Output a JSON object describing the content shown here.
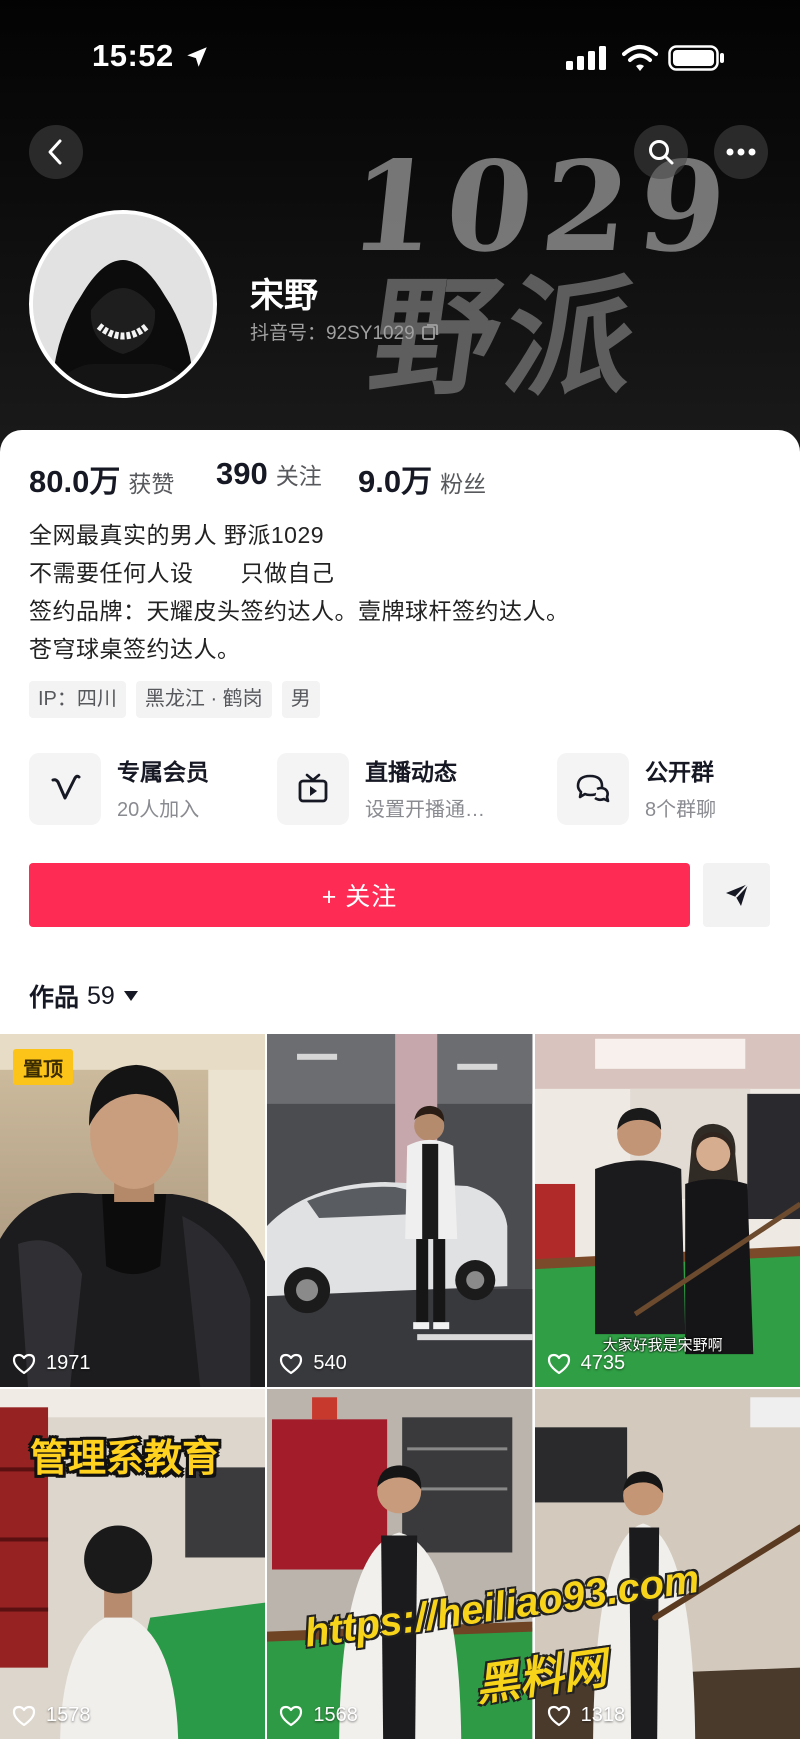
{
  "status_bar": {
    "time": "15:52",
    "icons": [
      "location-arrow-icon",
      "signal-icon",
      "wifi-icon",
      "battery-icon"
    ]
  },
  "banner": {
    "line1": "1029",
    "line2": "野派"
  },
  "profile": {
    "name": "宋野",
    "douyin_id": "抖音号：92SY1029"
  },
  "stats": [
    {
      "value": "80.0万",
      "label": "获赞"
    },
    {
      "value": "390",
      "label": "关注"
    },
    {
      "value": "9.0万",
      "label": "粉丝"
    }
  ],
  "bio": [
    "全网最真实的男人 野派1029",
    "不需要任何人设　　只做自己",
    "签约品牌：天耀皮头签约达人。壹牌球杆签约达人。",
    "苍穹球桌签约达人。"
  ],
  "tags": [
    "IP：四川",
    "黑龙江 · 鹤岗",
    "男"
  ],
  "features": [
    {
      "title": "专属会员",
      "subtitle": "20人加入",
      "icon": "member-v-icon"
    },
    {
      "title": "直播动态",
      "subtitle": "设置开播通…",
      "icon": "tv-icon"
    },
    {
      "title": "公开群",
      "subtitle": "8个群聊",
      "icon": "chat-bubbles-icon"
    }
  ],
  "follow_button": {
    "label": "+ 关注"
  },
  "works": {
    "label": "作品",
    "count": "59"
  },
  "videos": [
    {
      "likes": "1971",
      "badge": "置顶"
    },
    {
      "likes": "540"
    },
    {
      "likes": "4735",
      "caption": "大家好我是宋野啊"
    },
    {
      "likes": "1578",
      "overlay": "管理系教育"
    },
    {
      "likes": "1568"
    },
    {
      "likes": "1318"
    }
  ],
  "watermark": {
    "url": "https://heiliao93.com",
    "name": "黑料网"
  },
  "colors": {
    "accent": "#fe2c55",
    "pin_badge": "#fcc419"
  }
}
